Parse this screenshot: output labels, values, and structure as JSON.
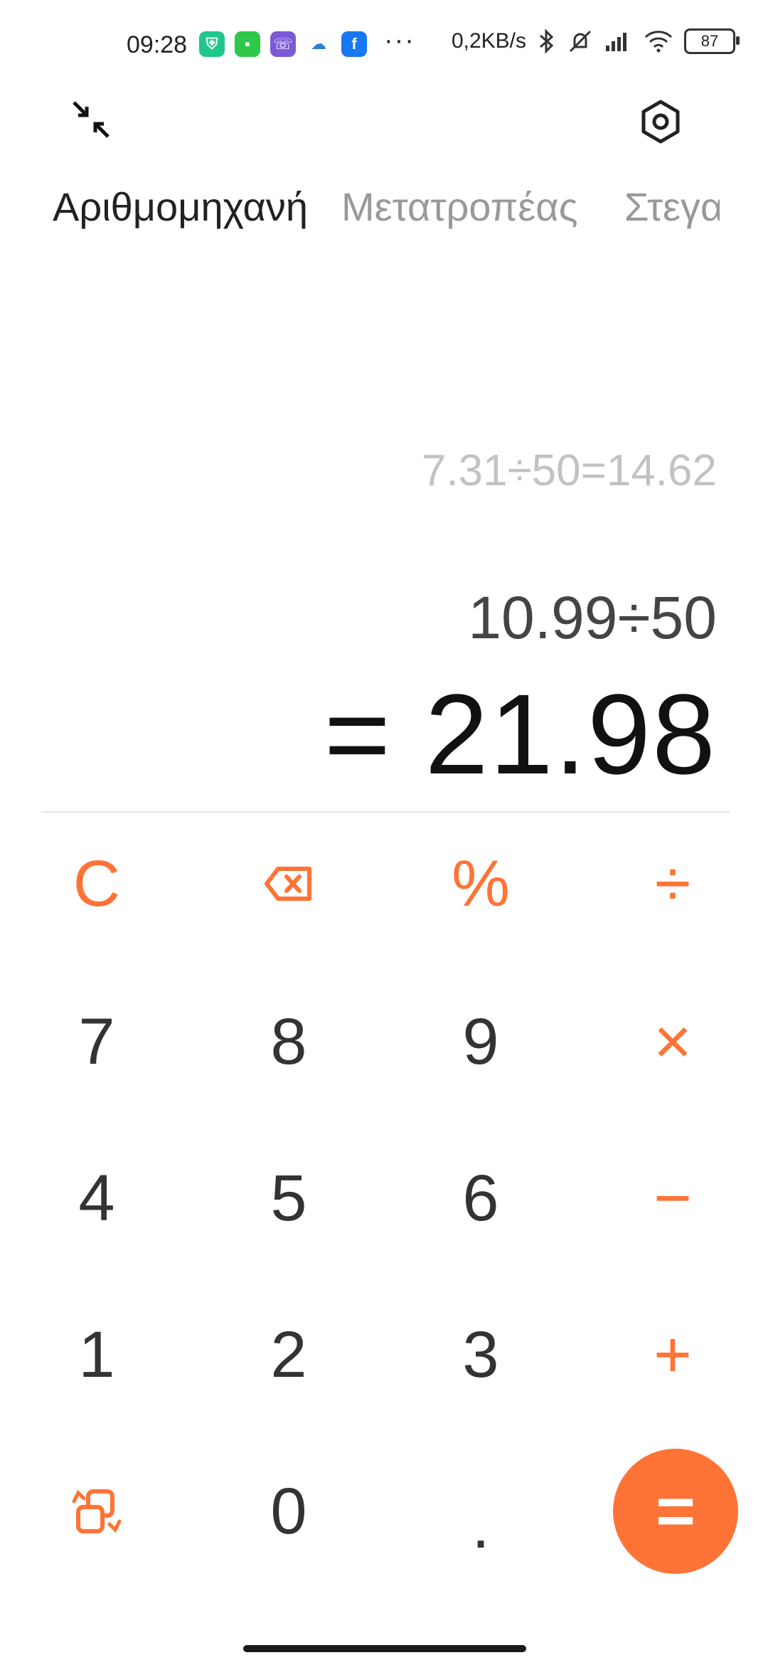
{
  "status_bar": {
    "time": "09:28",
    "network_speed": "0,2KB/s",
    "battery": "87",
    "app_icons": [
      "shield-app-icon",
      "chat-app-icon",
      "viber-icon",
      "weather-icon",
      "facebook-icon"
    ],
    "more": "···"
  },
  "tabs": [
    {
      "label": "Αριθμομηχανή"
    },
    {
      "label": "Μετατροπέας"
    },
    {
      "label": "Στεγα"
    }
  ],
  "display": {
    "history": "7.31÷50=14.62",
    "expression": "10.99÷50",
    "result": "= 21.98"
  },
  "keys": {
    "clear": "C",
    "backspace_icon": "backspace-icon",
    "percent": "%",
    "divide": "÷",
    "multiply": "×",
    "minus": "−",
    "plus": "+",
    "seven": "7",
    "eight": "8",
    "nine": "9",
    "four": "4",
    "five": "5",
    "six": "6",
    "one": "1",
    "two": "2",
    "three": "3",
    "zero": "0",
    "dot": ".",
    "equals": "="
  },
  "colors": {
    "accent": "#ff7336",
    "text": "#333333",
    "history": "#c2c2c2"
  }
}
